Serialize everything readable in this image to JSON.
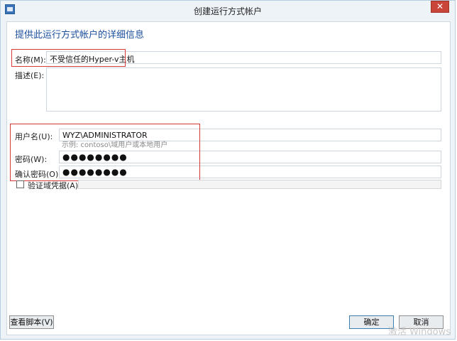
{
  "window": {
    "title": "创建运行方式帐户",
    "close_glyph": "✕"
  },
  "heading": "提供此运行方式帐户的详细信息",
  "form": {
    "name_label": "名称(M):",
    "name_value": "不受信任的Hyper-v主机",
    "description_label": "描述(E):",
    "description_value": "",
    "username_label": "用户名(U):",
    "username_value": "WYZ\\ADMINISTRATOR",
    "username_hint": "示例: contoso\\域用户或本地用户",
    "password_label": "密码(W):",
    "password_value": "●●●●●●●●",
    "confirm_label": "确认密码(O):",
    "confirm_value": "●●●●●●●●",
    "validate_label": "验证域凭据(A)",
    "validate_checked": false
  },
  "buttons": {
    "view_script": "查看脚本(V)",
    "ok": "确定",
    "cancel": "取消"
  },
  "watermark": "激活 Windows"
}
